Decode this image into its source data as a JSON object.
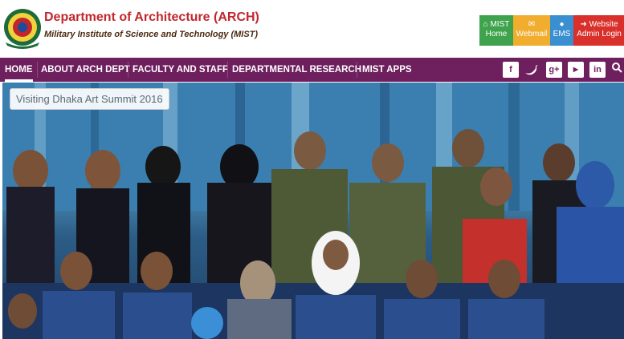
{
  "header": {
    "dept_title": "Department of Architecture (ARCH)",
    "inst_name": "Military Institute of Science and Technology (MIST)"
  },
  "quick_links": [
    {
      "icon": "home-icon",
      "line1": "MIST",
      "line2": "Home",
      "color": "#3fa34d"
    },
    {
      "icon": "mail-icon",
      "line1": "",
      "line2": "Webmail",
      "color": "#f0ad2e"
    },
    {
      "icon": "user-icon",
      "line1": "",
      "line2": "EMS",
      "color": "#3a8fd0"
    },
    {
      "icon": "signin-icon",
      "line1": "Website",
      "line2": "Admin Login",
      "color": "#d9302c"
    }
  ],
  "nav": {
    "items": [
      "HOME",
      "ABOUT ARCH DEPT",
      "FACULTY AND STAFF",
      "DEPARTMENTAL RESEARCH",
      "MIST APPS"
    ],
    "social": [
      "facebook-icon",
      "twitter-icon",
      "google-plus-icon",
      "youtube-icon",
      "linkedin-icon",
      "search-icon"
    ],
    "bg_color": "#6e1f5e"
  },
  "hero": {
    "caption": "Visiting Dhaka Art Summit 2016"
  }
}
